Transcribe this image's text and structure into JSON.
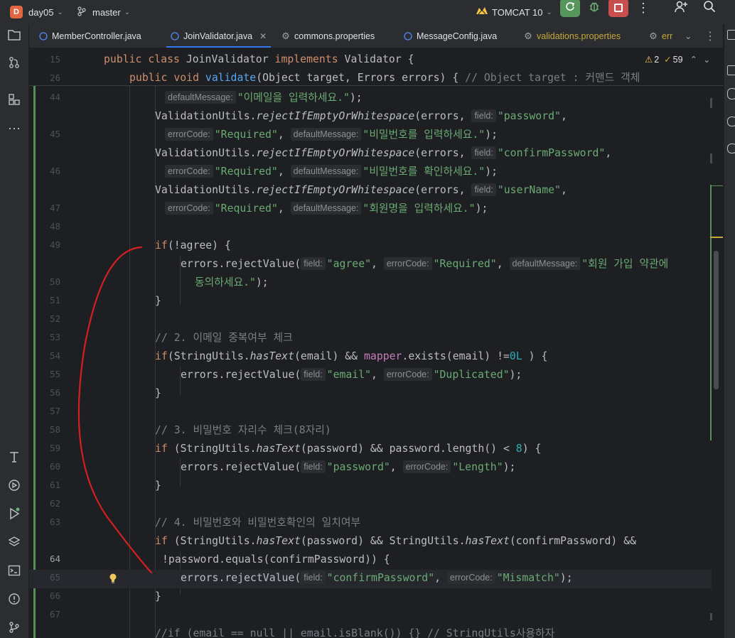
{
  "titlebar": {
    "project_badge": "D",
    "project_name": "day05",
    "branch": "master",
    "run_config": "TOMCAT 10"
  },
  "tabs": [
    {
      "label": "MemberController.java",
      "icon": "java-class-icon"
    },
    {
      "label": "JoinValidator.java",
      "icon": "java-class-icon",
      "active": true
    },
    {
      "label": "commons.properties",
      "icon": "gear-icon"
    },
    {
      "label": "MessageConfig.java",
      "icon": "java-class-icon"
    },
    {
      "label": "validations.properties",
      "icon": "gear-icon"
    },
    {
      "label": "err",
      "icon": "gear-icon"
    }
  ],
  "inspection": {
    "warnings": "2",
    "weak_warnings": "59"
  },
  "hints": {
    "field": "field:",
    "errorCode": "errorCode:",
    "defaultMessage": "defaultMessage:"
  },
  "lines": {
    "n15": "15",
    "n26": "26",
    "n44": "44",
    "n45": "45",
    "n46": "46",
    "n47": "47",
    "n48": "48",
    "n49": "49",
    "n50": "50",
    "n51": "51",
    "n52": "52",
    "n53": "53",
    "n54": "54",
    "n55": "55",
    "n56": "56",
    "n57": "57",
    "n58": "58",
    "n59": "59",
    "n60": "60",
    "n61": "61",
    "n62": "62",
    "n63": "63",
    "n64": "64",
    "n65": "65",
    "n66": "66",
    "n67": "67"
  },
  "code": {
    "l15": "JoinValidator",
    "l15_iface": "Validator",
    "l26_comment": "// Object target : 커맨드 객체",
    "msg_email": "\"이메일을 입력하세요.\"",
    "s_password": "\"password\"",
    "s_required": "\"Required\"",
    "msg_password": "\"비밀번호를 입력하세요.\"",
    "s_confirm": "\"confirmPassword\"",
    "msg_confirm": "\"비밀번호를 확인하세요.\"",
    "s_username": "\"userName\"",
    "msg_username": "\"회원명을 입력하세요.\"",
    "s_agree": "\"agree\"",
    "msg_agree_1": "\"회원 가입 약관에",
    "msg_agree_2": "동의하세요.\"",
    "c52": "// 2. 이메일 중복여부 체크",
    "s_email": "\"email\"",
    "s_duplicated": "\"Duplicated\"",
    "c57": "// 3. 비밀번호 자리수 체크(8자리)",
    "s_length": "\"Length\"",
    "c62": "// 4. 비밀번호와 비밀번호확인의 일치여부",
    "s_mismatch": "\"Mismatch\"",
    "c67": "//if (email == null || email.isBlank()) {} // StringUtils사용하자"
  },
  "colors": {
    "keyword": "#cf8e6d",
    "string": "#6aab73",
    "method": "#56a8f5",
    "comment": "#7a7e85",
    "number": "#2aacb8",
    "annotation_stroke": "#d42020"
  }
}
